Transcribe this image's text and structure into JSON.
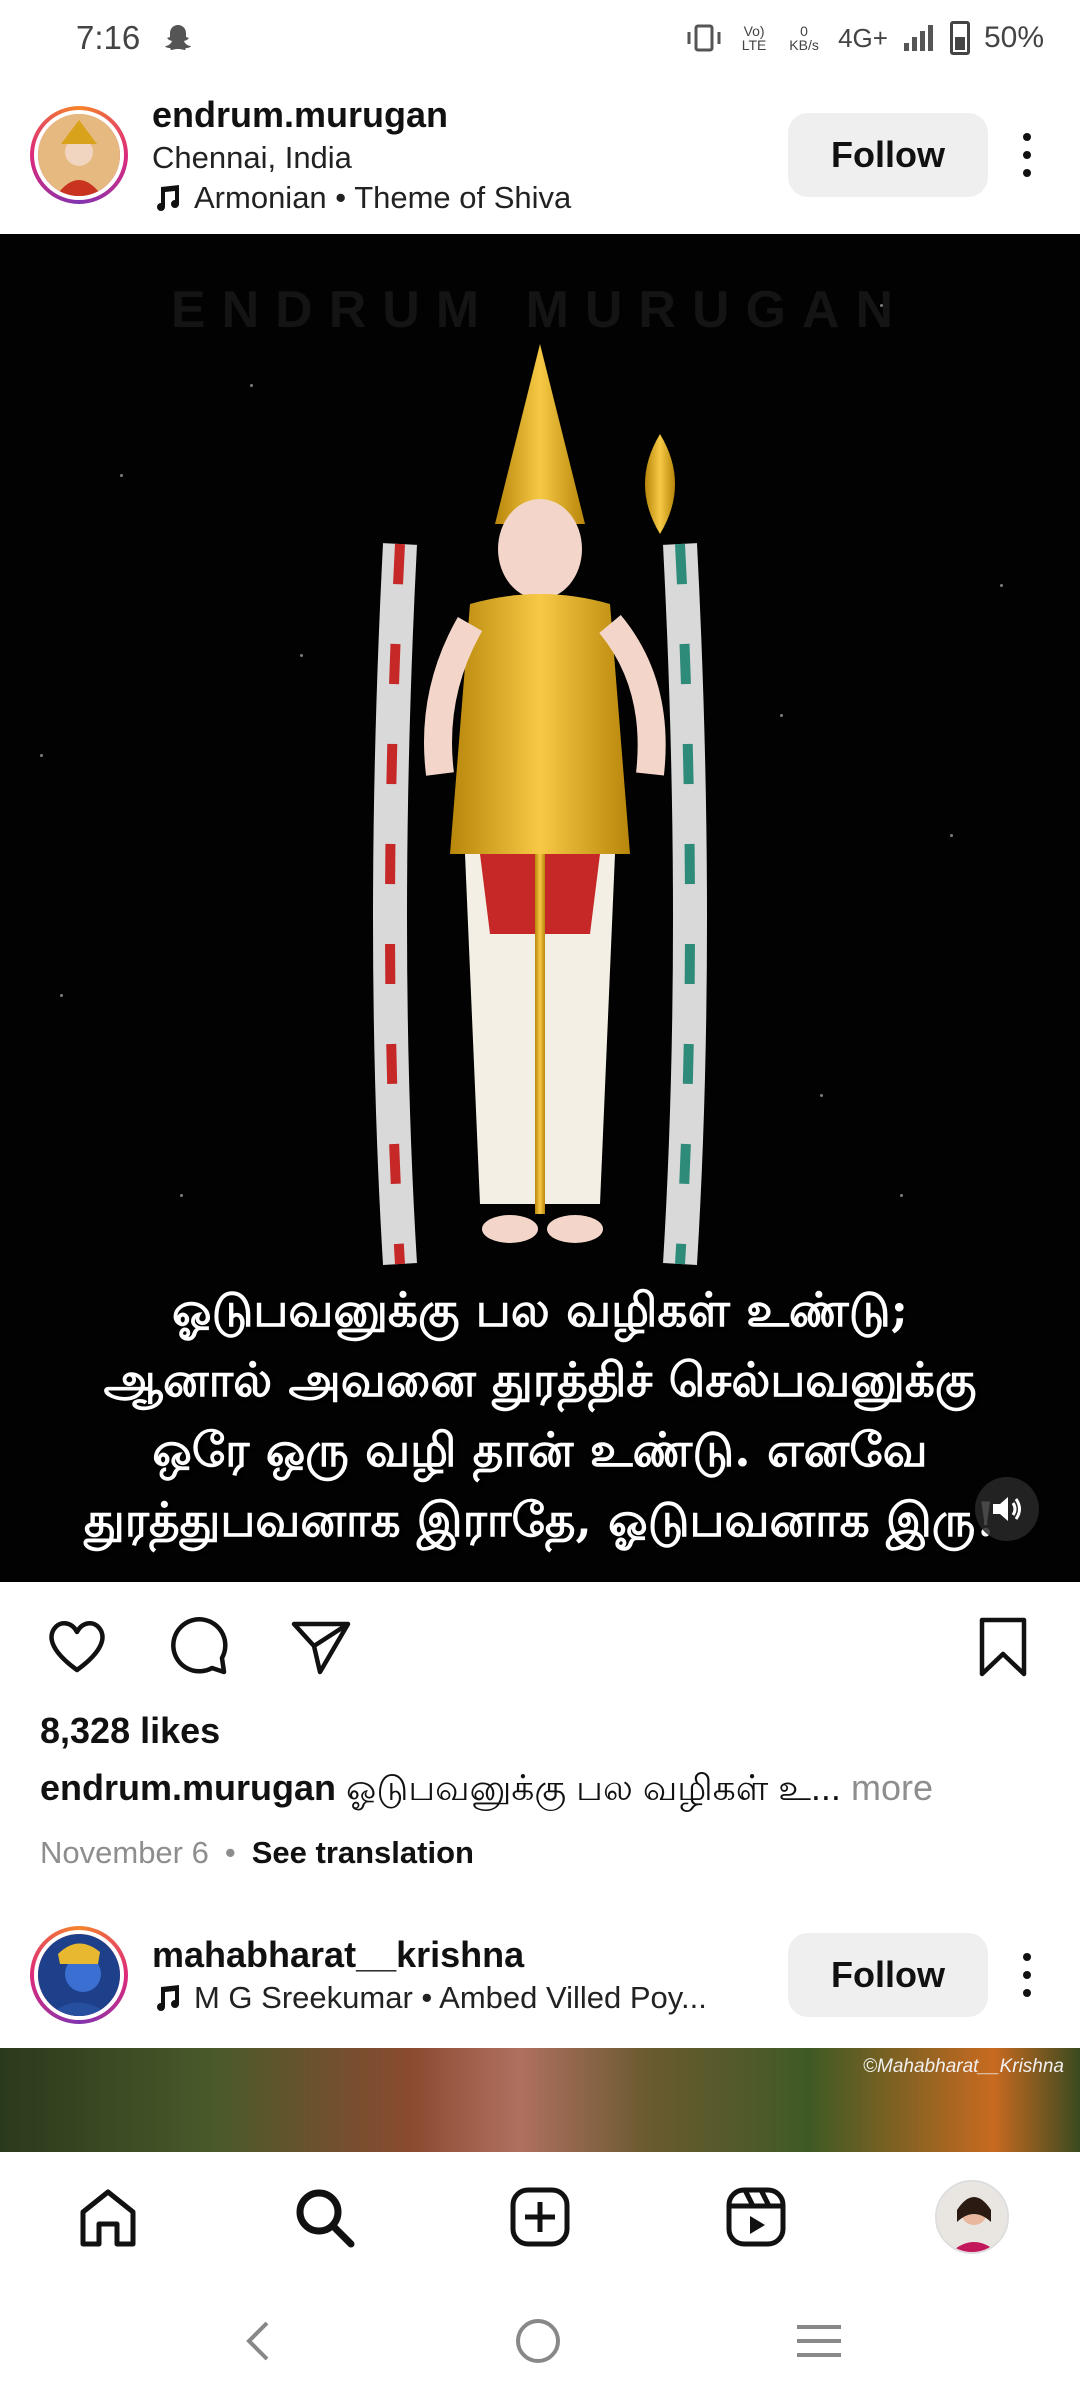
{
  "status_bar": {
    "time": "7:16",
    "network_rate_value": "0",
    "network_rate_unit": "KB/s",
    "volte": "Vo) LTE",
    "network": "4G+",
    "battery": "50%"
  },
  "post1": {
    "username": "endrum.murugan",
    "location": "Chennai, India",
    "audio": "Armonian • Theme of Shiva",
    "follow_label": "Follow",
    "image_watermark": "ENDRUM MURUGAN",
    "image_caption_lines": [
      "ஓடுபவனுக்கு பல வழிகள் உண்டு;",
      "ஆனால் அவனை துரத்திச் செல்பவனுக்கு",
      "ஒரே ஒரு வழி தான் உண்டு. எனவே",
      "துரத்துபவனாக இராதே, ஓடுபவனாக இரு!"
    ],
    "likes": "8,328 likes",
    "caption_username": "endrum.murugan",
    "caption_text": "ஓடுபவனுக்கு பல வழிகள் உ...",
    "more_label": "more",
    "date": "November 6",
    "separator": "•",
    "translate_label": "See translation"
  },
  "post2": {
    "username": "mahabharat__krishna",
    "audio": "M G Sreekumar • Ambed Villed Poy...",
    "follow_label": "Follow",
    "image_credit": "©Mahabharat__Krishna"
  },
  "colors": {
    "story_ring": "#dd2a7b",
    "follow_bg": "#efefef",
    "muted_text": "#8e8e8e"
  },
  "icons": {
    "status": [
      "snapchat-icon",
      "vibrate-icon",
      "signal-icon",
      "battery-icon"
    ],
    "actions": [
      "heart-icon",
      "comment-icon",
      "share-icon",
      "bookmark-icon"
    ],
    "nav": [
      "home-icon",
      "search-icon",
      "create-icon",
      "reels-icon",
      "profile-avatar"
    ],
    "system": [
      "back-icon",
      "home-circle-icon",
      "recents-icon"
    ]
  }
}
